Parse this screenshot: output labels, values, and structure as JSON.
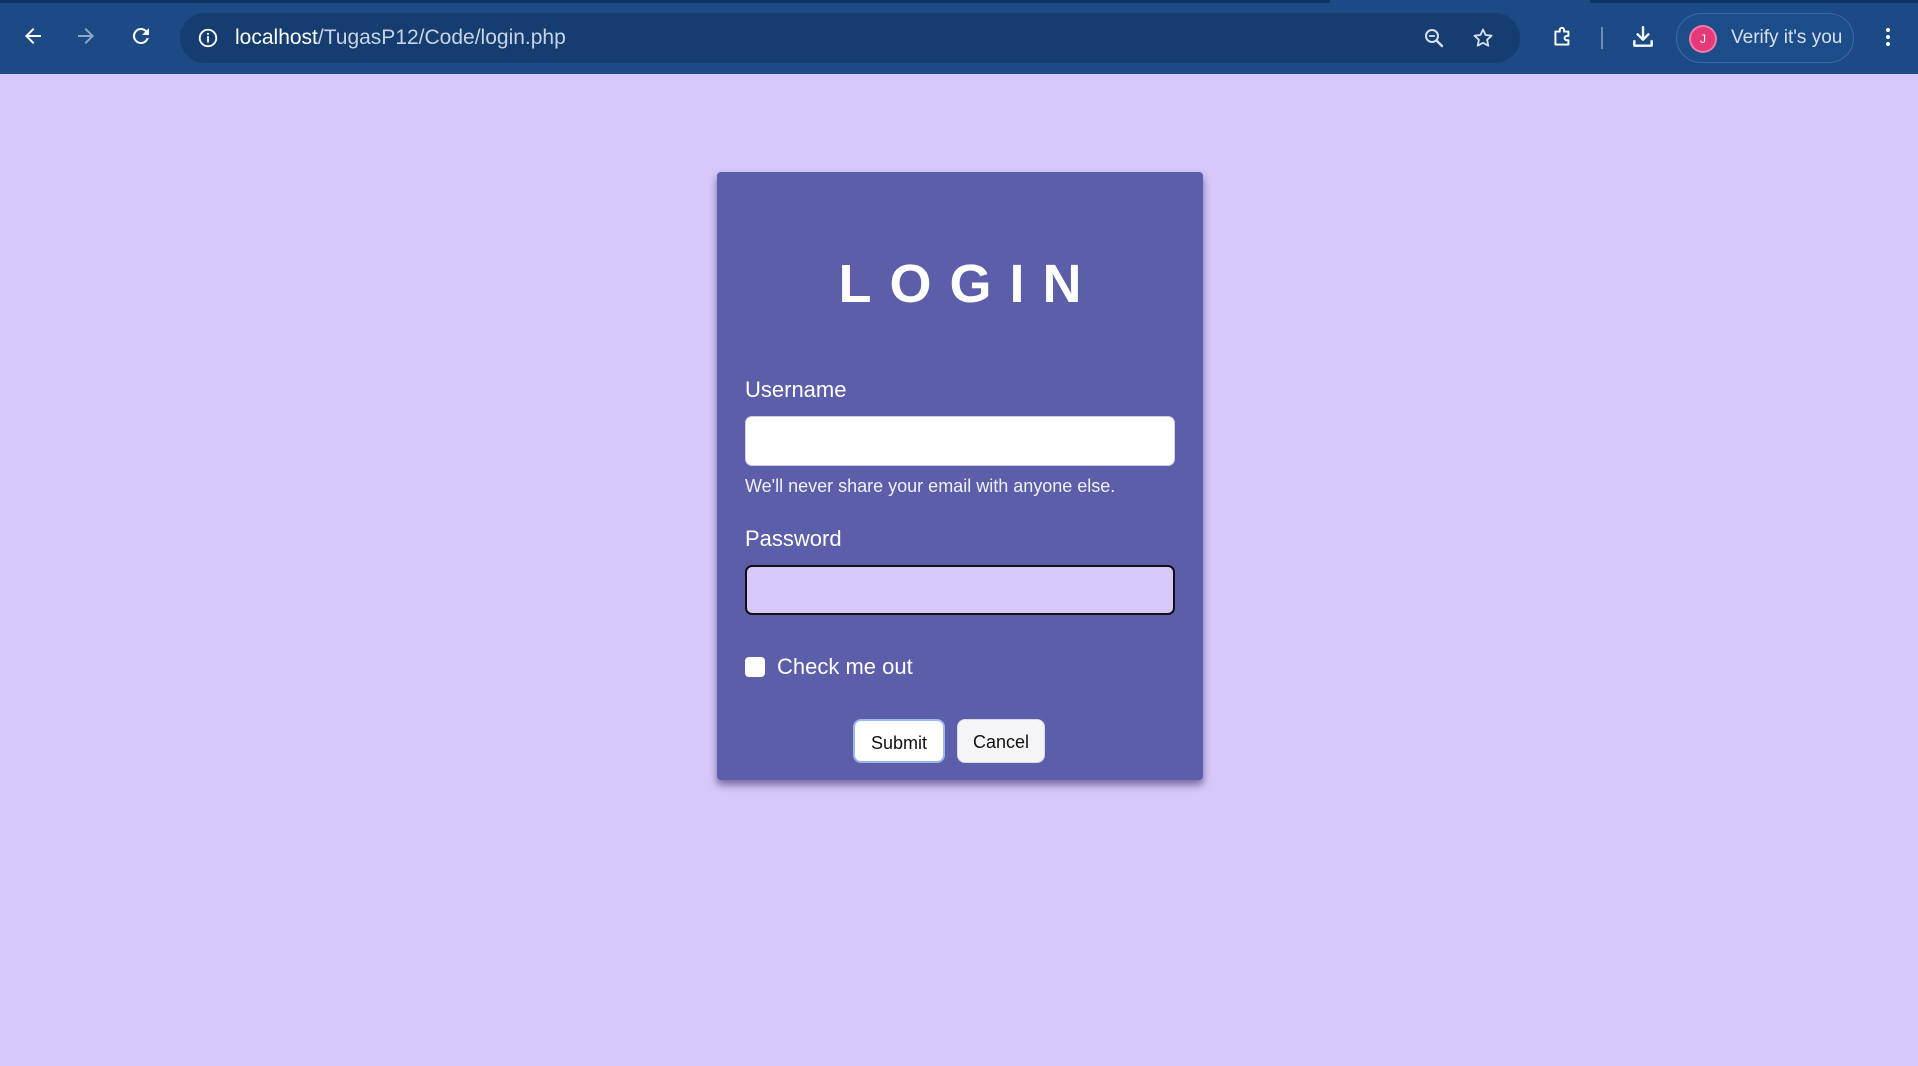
{
  "browser": {
    "url_host": "localhost",
    "url_path": "/TugasP12/Code/login.php",
    "profile_initial": "J",
    "profile_label": "Verify it's you"
  },
  "form": {
    "title": "LOGIN",
    "username_label": "Username",
    "username_value": "",
    "username_help": "We'll never share your email with anyone else.",
    "password_label": "Password",
    "password_value": "",
    "checkbox_label": "Check me out",
    "checkbox_checked": false,
    "submit_label": "Submit",
    "cancel_label": "Cancel"
  },
  "colors": {
    "page_background": "#d6c8f8",
    "card_background": "#5c5ea9",
    "toolbar_background": "#1b4a84"
  },
  "icons": {
    "back": "back-arrow-icon",
    "forward": "forward-arrow-icon",
    "reload": "reload-icon",
    "site_info": "info-icon",
    "zoom": "zoom-icon",
    "bookmark": "star-icon",
    "extensions": "puzzle-icon",
    "downloads": "download-icon",
    "menu": "kebab-menu-icon"
  }
}
